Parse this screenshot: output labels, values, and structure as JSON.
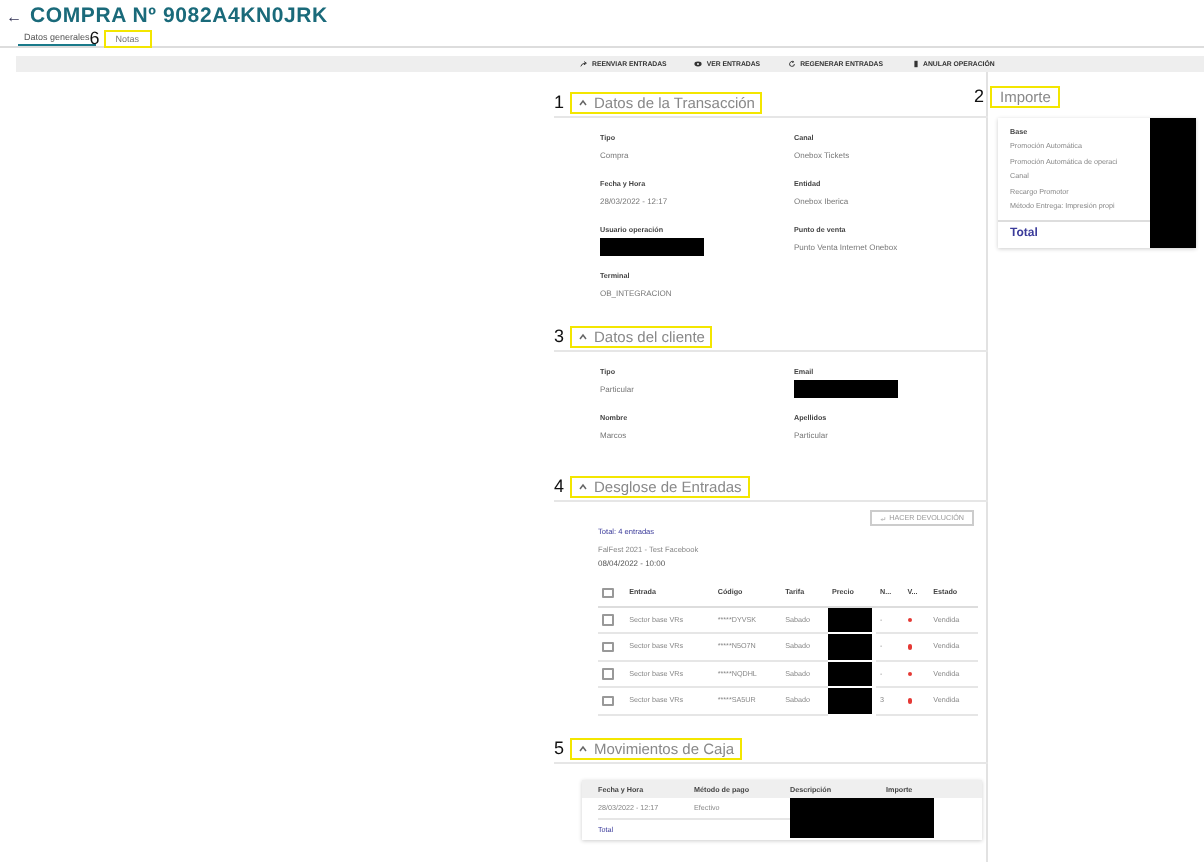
{
  "header": {
    "back": "←",
    "title": "COMPRA Nº 9082A4KN0JRK"
  },
  "tabs": [
    {
      "label": "Datos generales",
      "selected": true,
      "highlighted": false
    },
    {
      "label": "Notas",
      "selected": false,
      "highlighted": true,
      "callout": "6"
    }
  ],
  "toolbar": [
    {
      "label": "REENVIAR ENTRADAS",
      "kind": "send"
    },
    {
      "label": "VER ENTRADAS",
      "kind": "eye"
    },
    {
      "label": "REGENERAR ENTRADAS",
      "kind": "refresh"
    },
    {
      "label": "ANULAR OPERACIÓN",
      "kind": "trash"
    }
  ],
  "transaction": {
    "callout": "1",
    "title": "Datos de la Transacción",
    "highlighted": true,
    "fields": [
      {
        "label": "Tipo",
        "value": "Compra"
      },
      {
        "label": "Canal",
        "value": "Onebox Tickets"
      },
      {
        "label": "Fecha y Hora",
        "value": "28/03/2022 - 12:17"
      },
      {
        "label": "Entidad",
        "value": "Onebox Iberica"
      },
      {
        "label": "Usuario operación"
      },
      {
        "label": "Punto de venta",
        "value": "Punto Venta Internet Onebox"
      },
      {
        "label": "Terminal",
        "value": "OB_INTEGRACION"
      }
    ]
  },
  "client": {
    "callout": "3",
    "title": "Datos del cliente",
    "highlighted": true,
    "fields": [
      {
        "label": "Tipo",
        "value": "Particular"
      },
      {
        "label": "Email"
      },
      {
        "label": "Nombre",
        "value": "Marcos"
      },
      {
        "label": "Apellidos",
        "value": "Particular"
      }
    ]
  },
  "tickets": {
    "callout": "4",
    "title": "Desglose de Entradas",
    "highlighted": true,
    "all_checked": false,
    "refund_button": "HACER DEVOLUCIÓN",
    "total": "Total: 4 entradas",
    "event": "FalFest 2021 - Test Facebook",
    "date": "08/04/2022 - 10:00",
    "columns": [
      "Entrada",
      "Código",
      "Tarifa",
      "Precio",
      "N...",
      "V...",
      "Estado"
    ],
    "rows": [
      {
        "checked": false,
        "entrada": "Sector base VRs",
        "codigo": "*****DYVSK",
        "tarifa": "Sabado",
        "n": "-",
        "color": "#e53935",
        "estado": "Vendida"
      },
      {
        "checked": false,
        "entrada": "Sector base VRs",
        "codigo": "*****N5O7N",
        "tarifa": "Sabado",
        "n": "-",
        "color": "#e53935",
        "estado": "Vendida"
      },
      {
        "checked": false,
        "entrada": "Sector base VRs",
        "codigo": "*****NQDHL",
        "tarifa": "Sabado",
        "n": "-",
        "color": "#e53935",
        "estado": "Vendida"
      },
      {
        "checked": false,
        "entrada": "Sector base VRs",
        "codigo": "*****SA5UR",
        "tarifa": "Sabado",
        "n": "3",
        "color": "#e53935",
        "estado": "Vendida"
      }
    ]
  },
  "cash": {
    "callout": "5",
    "title": "Movimientos de Caja",
    "highlighted": true,
    "columns": [
      "Fecha y Hora",
      "Método de pago",
      "Descripción",
      "Importe"
    ],
    "rows": [
      {
        "fecha": "28/03/2022 - 12:17",
        "metodo": "Efectivo"
      }
    ],
    "total": "Total"
  },
  "amount": {
    "callout": "2",
    "title": "Importe",
    "highlighted": true,
    "rows": [
      {
        "label": "Base",
        "kind": "head"
      },
      {
        "label": "Promoción Automática",
        "kind": "line"
      },
      {
        "label": "Promoción Automática de operaci",
        "kind": "line"
      },
      {
        "label": "Canal",
        "kind": "line"
      },
      {
        "label": "Recargo Promotor",
        "kind": "line"
      },
      {
        "label": "Método Entrega: Impresión propi",
        "kind": "line"
      }
    ],
    "total": "Total"
  }
}
